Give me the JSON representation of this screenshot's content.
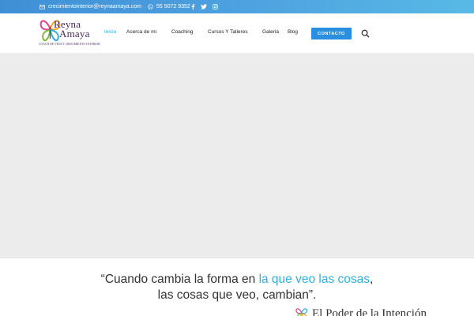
{
  "topbar": {
    "email": "crecimientointerior@reynaamaya.com",
    "phone": "55 5072 9352",
    "social_icons": [
      "facebook-icon",
      "twitter-icon",
      "instagram-icon"
    ]
  },
  "logo": {
    "line1": "Reyna",
    "line2": "Amaya",
    "tagline": "COACH DE VIDA Y CRECIMIENTO INTERIOR"
  },
  "nav": {
    "items": [
      {
        "label": "Inicio",
        "active": true
      },
      {
        "label": "Acerca de mi",
        "active": false
      },
      {
        "label": "Coaching",
        "active": false
      },
      {
        "label": "Cursos Y Talleres",
        "active": false
      },
      {
        "label": "Galeria",
        "active": false
      },
      {
        "label": "Blog",
        "active": false
      }
    ],
    "contact_button": "CONTACTO"
  },
  "quote": {
    "part1": "“Cuando cambia la forma en ",
    "highlight": "la que veo las cosas",
    "part2": ",",
    "line2": "las cosas que veo, cambian”."
  },
  "section_title": "El Poder de la Intención",
  "colors": {
    "topbar_start": "#3f8fd6",
    "topbar_end": "#58b9e6",
    "accent": "#2aaee8",
    "button": "#2b8fe0",
    "hero_bg": "#ececec",
    "logo_text": "#4a2a5e"
  }
}
